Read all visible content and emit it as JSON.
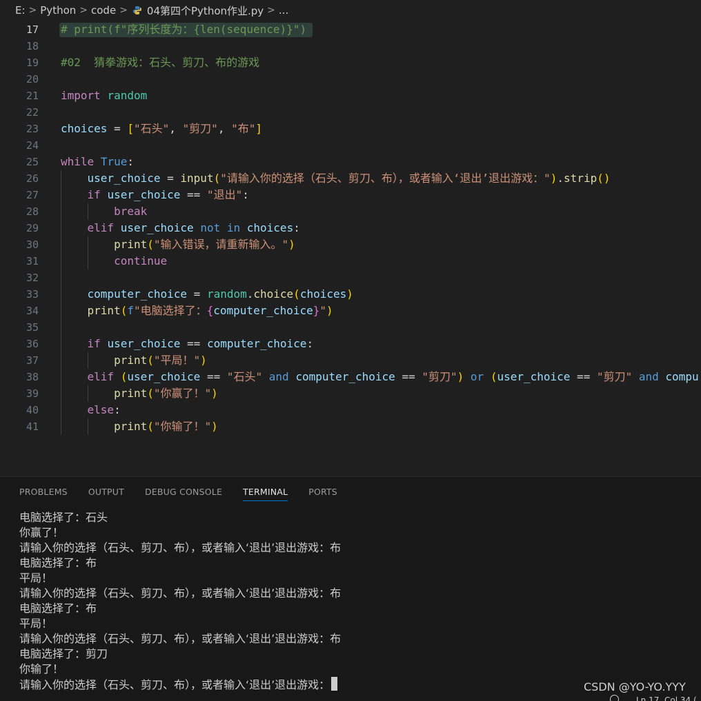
{
  "breadcrumb": {
    "drive": "E:",
    "folder1": "Python",
    "folder2": "code",
    "file": "04第四个Python作业.py",
    "more": "..."
  },
  "editor": {
    "line_numbers": [
      "17",
      "18",
      "19",
      "20",
      "21",
      "22",
      "23",
      "24",
      "25",
      "26",
      "27",
      "28",
      "29",
      "30",
      "31",
      "32",
      "33",
      "34",
      "35",
      "36",
      "37",
      "38",
      "39",
      "40",
      "41"
    ],
    "active_line": "17",
    "lines": [
      [
        {
          "t": "# print(f\"序列长度为：{len(sequence)}\")",
          "c": "c-comment"
        }
      ],
      [],
      [
        {
          "t": "#02  猜拳游戏：石头、剪刀、布的游戏",
          "c": "c-comment"
        }
      ],
      [],
      [
        {
          "t": "import",
          "c": "c-kw"
        },
        {
          "t": " ",
          "c": ""
        },
        {
          "t": "random",
          "c": "c-mod"
        }
      ],
      [],
      [
        {
          "t": "choices",
          "c": "c-var"
        },
        {
          "t": " = ",
          "c": "c-op"
        },
        {
          "t": "[",
          "c": "c-p1"
        },
        {
          "t": "\"石头\"",
          "c": "c-str"
        },
        {
          "t": ", ",
          "c": "c-op"
        },
        {
          "t": "\"剪刀\"",
          "c": "c-str"
        },
        {
          "t": ", ",
          "c": "c-op"
        },
        {
          "t": "\"布\"",
          "c": "c-str"
        },
        {
          "t": "]",
          "c": "c-p1"
        }
      ],
      [],
      [
        {
          "t": "while",
          "c": "c-kw"
        },
        {
          "t": " ",
          "c": ""
        },
        {
          "t": "True",
          "c": "c-ctrl"
        },
        {
          "t": ":",
          "c": "c-op"
        }
      ],
      [
        {
          "t": "    ",
          "c": ""
        },
        {
          "t": "user_choice",
          "c": "c-var"
        },
        {
          "t": " = ",
          "c": "c-op"
        },
        {
          "t": "input",
          "c": "c-fn"
        },
        {
          "t": "(",
          "c": "c-p1"
        },
        {
          "t": "\"请输入你的选择（石头、剪刀、布），或者输入‘退出’退出游戏：\"",
          "c": "c-str"
        },
        {
          "t": ")",
          "c": "c-p1"
        },
        {
          "t": ".",
          "c": "c-op"
        },
        {
          "t": "strip",
          "c": "c-fn"
        },
        {
          "t": "()",
          "c": "c-p1"
        }
      ],
      [
        {
          "t": "    ",
          "c": ""
        },
        {
          "t": "if",
          "c": "c-kw"
        },
        {
          "t": " ",
          "c": ""
        },
        {
          "t": "user_choice",
          "c": "c-var"
        },
        {
          "t": " == ",
          "c": "c-op"
        },
        {
          "t": "\"退出\"",
          "c": "c-str"
        },
        {
          "t": ":",
          "c": "c-op"
        }
      ],
      [
        {
          "t": "        ",
          "c": ""
        },
        {
          "t": "break",
          "c": "c-kw"
        }
      ],
      [
        {
          "t": "    ",
          "c": ""
        },
        {
          "t": "elif",
          "c": "c-kw"
        },
        {
          "t": " ",
          "c": ""
        },
        {
          "t": "user_choice",
          "c": "c-var"
        },
        {
          "t": " ",
          "c": ""
        },
        {
          "t": "not",
          "c": "c-ctrl"
        },
        {
          "t": " ",
          "c": ""
        },
        {
          "t": "in",
          "c": "c-ctrl"
        },
        {
          "t": " ",
          "c": ""
        },
        {
          "t": "choices",
          "c": "c-var"
        },
        {
          "t": ":",
          "c": "c-op"
        }
      ],
      [
        {
          "t": "        ",
          "c": ""
        },
        {
          "t": "print",
          "c": "c-fn"
        },
        {
          "t": "(",
          "c": "c-p1"
        },
        {
          "t": "\"输入错误，请重新输入。\"",
          "c": "c-str"
        },
        {
          "t": ")",
          "c": "c-p1"
        }
      ],
      [
        {
          "t": "        ",
          "c": ""
        },
        {
          "t": "continue",
          "c": "c-kw"
        }
      ],
      [],
      [
        {
          "t": "    ",
          "c": ""
        },
        {
          "t": "computer_choice",
          "c": "c-var"
        },
        {
          "t": " = ",
          "c": "c-op"
        },
        {
          "t": "random",
          "c": "c-mod"
        },
        {
          "t": ".",
          "c": "c-op"
        },
        {
          "t": "choice",
          "c": "c-fn"
        },
        {
          "t": "(",
          "c": "c-p1"
        },
        {
          "t": "choices",
          "c": "c-var"
        },
        {
          "t": ")",
          "c": "c-p1"
        }
      ],
      [
        {
          "t": "    ",
          "c": ""
        },
        {
          "t": "print",
          "c": "c-fn"
        },
        {
          "t": "(",
          "c": "c-p1"
        },
        {
          "t": "f",
          "c": "c-ctrl"
        },
        {
          "t": "\"电脑选择了：",
          "c": "c-str"
        },
        {
          "t": "{",
          "c": "c-p2"
        },
        {
          "t": "computer_choice",
          "c": "c-var"
        },
        {
          "t": "}",
          "c": "c-p2"
        },
        {
          "t": "\"",
          "c": "c-str"
        },
        {
          "t": ")",
          "c": "c-p1"
        }
      ],
      [],
      [
        {
          "t": "    ",
          "c": ""
        },
        {
          "t": "if",
          "c": "c-kw"
        },
        {
          "t": " ",
          "c": ""
        },
        {
          "t": "user_choice",
          "c": "c-var"
        },
        {
          "t": " == ",
          "c": "c-op"
        },
        {
          "t": "computer_choice",
          "c": "c-var"
        },
        {
          "t": ":",
          "c": "c-op"
        }
      ],
      [
        {
          "t": "        ",
          "c": ""
        },
        {
          "t": "print",
          "c": "c-fn"
        },
        {
          "t": "(",
          "c": "c-p1"
        },
        {
          "t": "\"平局！\"",
          "c": "c-str"
        },
        {
          "t": ")",
          "c": "c-p1"
        }
      ],
      [
        {
          "t": "    ",
          "c": ""
        },
        {
          "t": "elif",
          "c": "c-kw"
        },
        {
          "t": " ",
          "c": ""
        },
        {
          "t": "(",
          "c": "c-p1"
        },
        {
          "t": "user_choice",
          "c": "c-var"
        },
        {
          "t": " == ",
          "c": "c-op"
        },
        {
          "t": "\"石头\"",
          "c": "c-str"
        },
        {
          "t": " ",
          "c": ""
        },
        {
          "t": "and",
          "c": "c-ctrl"
        },
        {
          "t": " ",
          "c": ""
        },
        {
          "t": "computer_choice",
          "c": "c-var"
        },
        {
          "t": " == ",
          "c": "c-op"
        },
        {
          "t": "\"剪刀\"",
          "c": "c-str"
        },
        {
          "t": ")",
          "c": "c-p1"
        },
        {
          "t": " ",
          "c": ""
        },
        {
          "t": "or",
          "c": "c-ctrl"
        },
        {
          "t": " ",
          "c": ""
        },
        {
          "t": "(",
          "c": "c-p1"
        },
        {
          "t": "user_choice",
          "c": "c-var"
        },
        {
          "t": " == ",
          "c": "c-op"
        },
        {
          "t": "\"剪刀\"",
          "c": "c-str"
        },
        {
          "t": " ",
          "c": ""
        },
        {
          "t": "and",
          "c": "c-ctrl"
        },
        {
          "t": " ",
          "c": ""
        },
        {
          "t": "compu",
          "c": "c-var"
        }
      ],
      [
        {
          "t": "        ",
          "c": ""
        },
        {
          "t": "print",
          "c": "c-fn"
        },
        {
          "t": "(",
          "c": "c-p1"
        },
        {
          "t": "\"你赢了！\"",
          "c": "c-str"
        },
        {
          "t": ")",
          "c": "c-p1"
        }
      ],
      [
        {
          "t": "    ",
          "c": ""
        },
        {
          "t": "else",
          "c": "c-kw"
        },
        {
          "t": ":",
          "c": "c-op"
        }
      ],
      [
        {
          "t": "        ",
          "c": ""
        },
        {
          "t": "print",
          "c": "c-fn"
        },
        {
          "t": "(",
          "c": "c-p1"
        },
        {
          "t": "\"你输了！\"",
          "c": "c-str"
        },
        {
          "t": ")",
          "c": "c-p1"
        }
      ]
    ]
  },
  "panel": {
    "tabs": [
      "PROBLEMS",
      "OUTPUT",
      "DEBUG CONSOLE",
      "TERMINAL",
      "PORTS"
    ],
    "active_tab": "TERMINAL"
  },
  "terminal": {
    "lines": [
      "电脑选择了：石头",
      "你赢了！",
      "请输入你的选择（石头、剪刀、布），或者输入‘退出’退出游戏：布",
      "电脑选择了：布",
      "平局！",
      "请输入你的选择（石头、剪刀、布），或者输入‘退出’退出游戏：布",
      "电脑选择了：布",
      "平局！",
      "请输入你的选择（石头、剪刀、布），或者输入‘退出’退出游戏：布",
      "电脑选择了：剪刀",
      "你输了！",
      "请输入你的选择（石头、剪刀、布），或者输入‘退出’退出游戏："
    ]
  },
  "watermark": "CSDN @YO-YO.YYY",
  "status": {
    "position": "Ln 17, Col 34 ("
  }
}
